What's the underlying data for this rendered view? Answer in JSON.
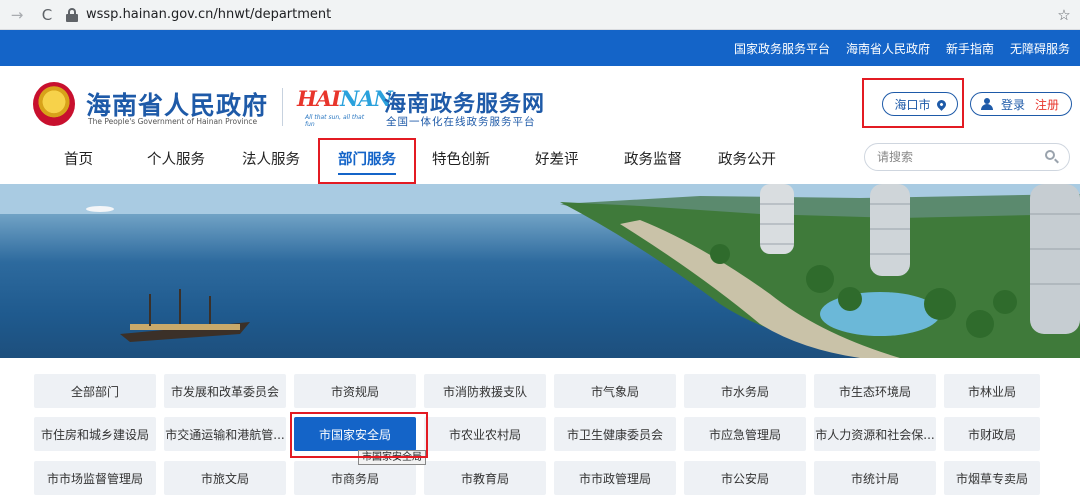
{
  "browser": {
    "back_icon": "→",
    "reload_icon": "C",
    "url": "wssp.hainan.gov.cn/hnwt/department",
    "star_icon": "☆"
  },
  "topbar": {
    "links": [
      "国家政务服务平台",
      "海南省人民政府",
      "新手指南",
      "无障碍服务"
    ]
  },
  "header": {
    "gov_title": "海南省人民政府",
    "gov_subtitle": "The People's Government of Hainan Province",
    "hainan_logo_text": "HAINAN",
    "hainan_logo_tag": "All that sun, all that fun",
    "service_title": "海南政务服务网",
    "service_subtitle": "全国一体化在线政务服务平台",
    "city": "海口市",
    "login": "登录",
    "register": "注册"
  },
  "nav": {
    "items": [
      "首页",
      "个人服务",
      "法人服务",
      "部门服务",
      "特色创新",
      "好差评",
      "政务监督",
      "政务公开"
    ],
    "active_index": 3,
    "search_placeholder": "请搜索"
  },
  "departments": {
    "rows": [
      [
        "全部部门",
        "市发展和改革委员会",
        "市资规局",
        "市消防救援支队",
        "市气象局",
        "市水务局",
        "市生态环境局",
        "市林业局"
      ],
      [
        "市住房和城乡建设局",
        "市交通运输和港航管...",
        "市国家安全局",
        "市农业农村局",
        "市卫生健康委员会",
        "市应急管理局",
        "市人力资源和社会保...",
        "市财政局"
      ],
      [
        "市市场监督管理局",
        "市旅文局",
        "市商务局",
        "市教育局",
        "市市政管理局",
        "市公安局",
        "市统计局",
        "市烟草专卖局"
      ]
    ],
    "active": "市国家安全局",
    "tooltip": "市国家安全局"
  },
  "colors": {
    "brand_blue": "#1464c8",
    "annotation_red": "#e31b23"
  }
}
